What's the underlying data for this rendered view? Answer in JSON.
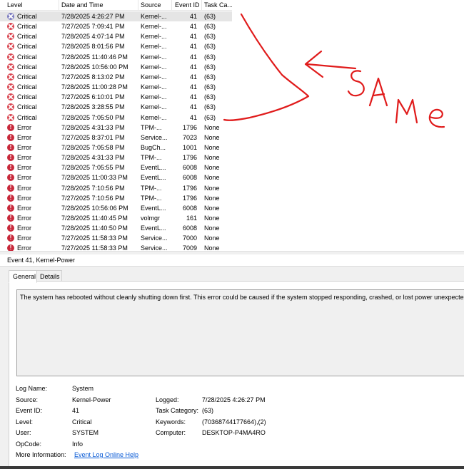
{
  "columns": {
    "level": "Level",
    "date": "Date and Time",
    "source": "Source",
    "event_id": "Event ID",
    "task": "Task Ca..."
  },
  "rows": [
    {
      "level": "Critical",
      "date": "7/28/2025 4:26:27 PM",
      "source": "Kernel-...",
      "id": "41",
      "task": "(63)",
      "type": "critical"
    },
    {
      "level": "Critical",
      "date": "7/27/2025 7:09:41 PM",
      "source": "Kernel-...",
      "id": "41",
      "task": "(63)",
      "type": "critical"
    },
    {
      "level": "Critical",
      "date": "7/28/2025 4:07:14 PM",
      "source": "Kernel-...",
      "id": "41",
      "task": "(63)",
      "type": "critical"
    },
    {
      "level": "Critical",
      "date": "7/28/2025 8:01:56 PM",
      "source": "Kernel-...",
      "id": "41",
      "task": "(63)",
      "type": "critical"
    },
    {
      "level": "Critical",
      "date": "7/28/2025 11:40:46 PM",
      "source": "Kernel-...",
      "id": "41",
      "task": "(63)",
      "type": "critical"
    },
    {
      "level": "Critical",
      "date": "7/28/2025 10:56:00 PM",
      "source": "Kernel-...",
      "id": "41",
      "task": "(63)",
      "type": "critical"
    },
    {
      "level": "Critical",
      "date": "7/27/2025 8:13:02 PM",
      "source": "Kernel-...",
      "id": "41",
      "task": "(63)",
      "type": "critical"
    },
    {
      "level": "Critical",
      "date": "7/28/2025 11:00:28 PM",
      "source": "Kernel-...",
      "id": "41",
      "task": "(63)",
      "type": "critical"
    },
    {
      "level": "Critical",
      "date": "7/27/2025 6:10:01 PM",
      "source": "Kernel-...",
      "id": "41",
      "task": "(63)",
      "type": "critical"
    },
    {
      "level": "Critical",
      "date": "7/28/2025 3:28:55 PM",
      "source": "Kernel-...",
      "id": "41",
      "task": "(63)",
      "type": "critical"
    },
    {
      "level": "Critical",
      "date": "7/28/2025 7:05:50 PM",
      "source": "Kernel-...",
      "id": "41",
      "task": "(63)",
      "type": "critical"
    },
    {
      "level": "Error",
      "date": "7/28/2025 4:31:33 PM",
      "source": "TPM-...",
      "id": "1796",
      "task": "None",
      "type": "error"
    },
    {
      "level": "Error",
      "date": "7/27/2025 8:37:01 PM",
      "source": "Service...",
      "id": "7023",
      "task": "None",
      "type": "error"
    },
    {
      "level": "Error",
      "date": "7/28/2025 7:05:58 PM",
      "source": "BugCh...",
      "id": "1001",
      "task": "None",
      "type": "error"
    },
    {
      "level": "Error",
      "date": "7/28/2025 4:31:33 PM",
      "source": "TPM-...",
      "id": "1796",
      "task": "None",
      "type": "error"
    },
    {
      "level": "Error",
      "date": "7/28/2025 7:05:55 PM",
      "source": "EventL...",
      "id": "6008",
      "task": "None",
      "type": "error"
    },
    {
      "level": "Error",
      "date": "7/28/2025 11:00:33 PM",
      "source": "EventL...",
      "id": "6008",
      "task": "None",
      "type": "error"
    },
    {
      "level": "Error",
      "date": "7/28/2025 7:10:56 PM",
      "source": "TPM-...",
      "id": "1796",
      "task": "None",
      "type": "error"
    },
    {
      "level": "Error",
      "date": "7/27/2025 7:10:56 PM",
      "source": "TPM-...",
      "id": "1796",
      "task": "None",
      "type": "error"
    },
    {
      "level": "Error",
      "date": "7/28/2025 10:56:06 PM",
      "source": "EventL...",
      "id": "6008",
      "task": "None",
      "type": "error"
    },
    {
      "level": "Error",
      "date": "7/28/2025 11:40:45 PM",
      "source": "volmgr",
      "id": "161",
      "task": "None",
      "type": "error"
    },
    {
      "level": "Error",
      "date": "7/28/2025 11:40:50 PM",
      "source": "EventL...",
      "id": "6008",
      "task": "None",
      "type": "error"
    },
    {
      "level": "Error",
      "date": "7/27/2025 11:58:33 PM",
      "source": "Service...",
      "id": "7000",
      "task": "None",
      "type": "error"
    },
    {
      "level": "Error",
      "date": "7/27/2025 11:58:33 PM",
      "source": "Service...",
      "id": "7009",
      "task": "None",
      "type": "error"
    }
  ],
  "detail": {
    "title": "Event 41, Kernel-Power",
    "tabs": [
      "General",
      "Details"
    ],
    "description": "The system has rebooted without cleanly shutting down first. This error could be caused if the system stopped responding, crashed, or lost power unexpectedly.",
    "log_name_label": "Log Name:",
    "log_name": "System",
    "source_label": "Source:",
    "source": "Kernel-Power",
    "logged_label": "Logged:",
    "logged": "7/28/2025 4:26:27 PM",
    "event_id_label": "Event ID:",
    "event_id": "41",
    "task_category_label": "Task Category:",
    "task_category": "(63)",
    "level_label": "Level:",
    "level": "Critical",
    "keywords_label": "Keywords:",
    "keywords": "(70368744177664),(2)",
    "user_label": "User:",
    "user": "SYSTEM",
    "computer_label": "Computer:",
    "computer": "DESKTOP-P4MA4RO",
    "opcode_label": "OpCode:",
    "opcode": "Info",
    "more_info_label": "More Information:",
    "more_info_link": "Event Log Online Help"
  },
  "annotation": {
    "text": "Same",
    "color": "#e01b1b"
  }
}
